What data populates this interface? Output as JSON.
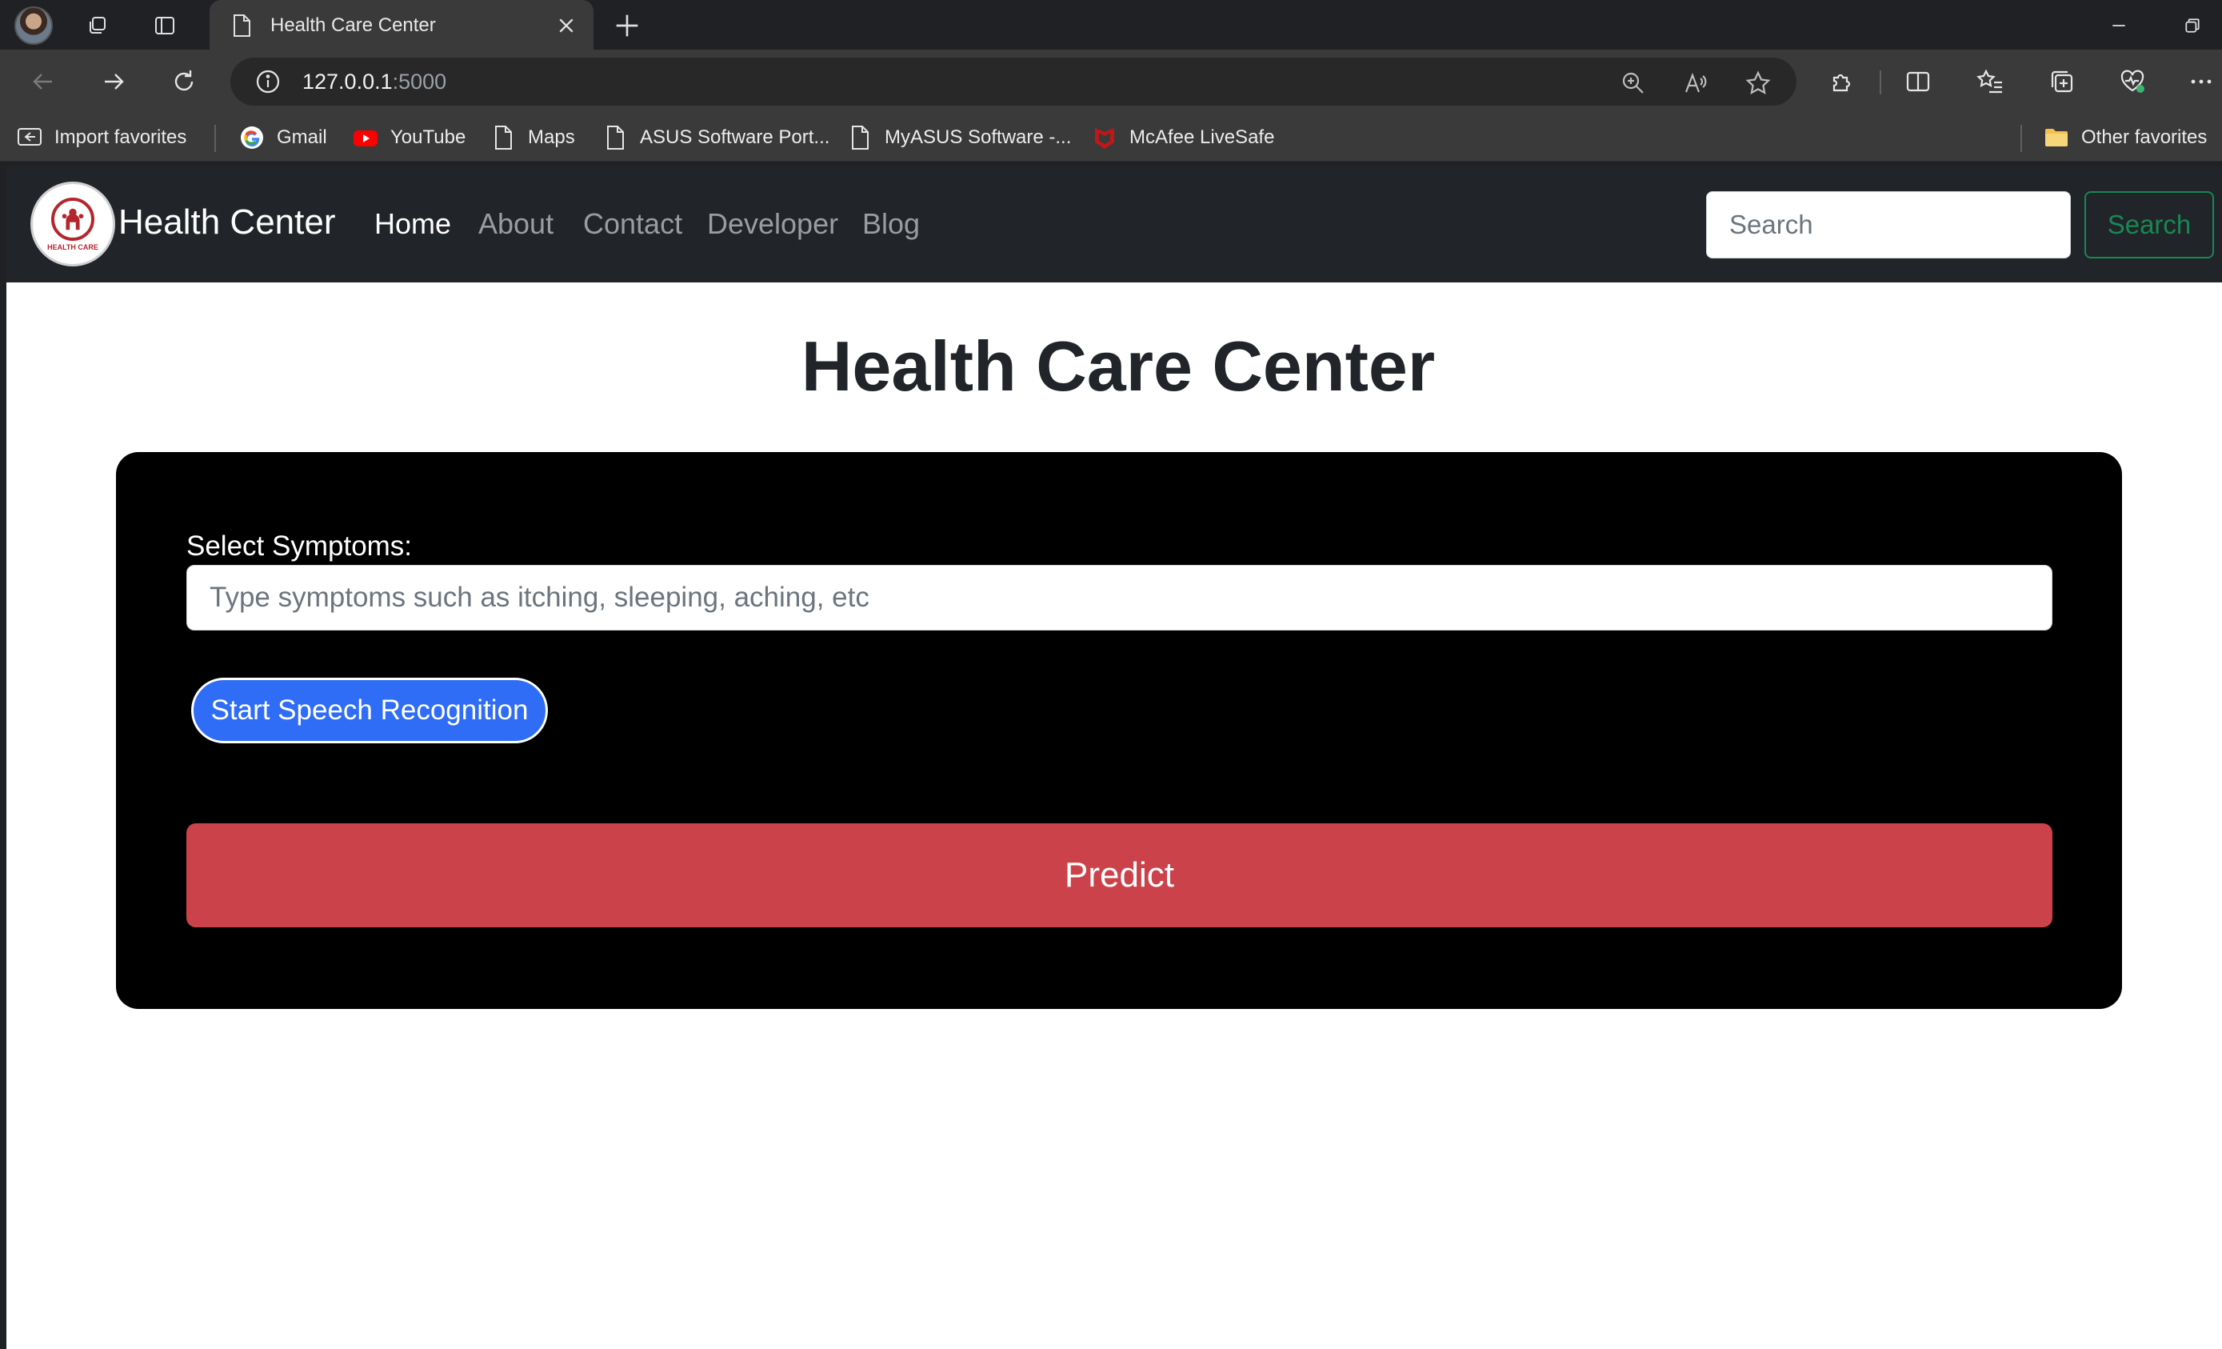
{
  "browser": {
    "tab_title": "Health Care Center",
    "url_host": "127.0.0.1",
    "url_port": ":5000",
    "bookmarks": [
      {
        "label": "Import favorites",
        "icon": "import-icon"
      },
      {
        "label": "Gmail",
        "icon": "google-icon"
      },
      {
        "label": "YouTube",
        "icon": "youtube-icon"
      },
      {
        "label": "Maps",
        "icon": "page-icon"
      },
      {
        "label": "ASUS Software Port...",
        "icon": "page-icon"
      },
      {
        "label": "MyASUS Software -...",
        "icon": "page-icon"
      },
      {
        "label": "McAfee LiveSafe",
        "icon": "mcafee-icon"
      }
    ],
    "other_favorites": "Other favorites"
  },
  "site": {
    "brand": "Health Center",
    "logo_text": "HEALTH CARE",
    "nav": [
      "Home",
      "About",
      "Contact",
      "Developer",
      "Blog"
    ],
    "search_placeholder": "Search",
    "search_button": "Search"
  },
  "main": {
    "title": "Health Care Center",
    "symptoms_label": "Select Symptoms:",
    "symptoms_placeholder": "Type symptoms such as itching, sleeping, aching, etc",
    "speech_button": "Start Speech Recognition",
    "predict_button": "Predict"
  },
  "colors": {
    "site_nav_bg": "#212529",
    "card_bg": "#000000",
    "speech_button": "#2f6df6",
    "predict_button": "#cc424a",
    "search_button": "#198754"
  }
}
